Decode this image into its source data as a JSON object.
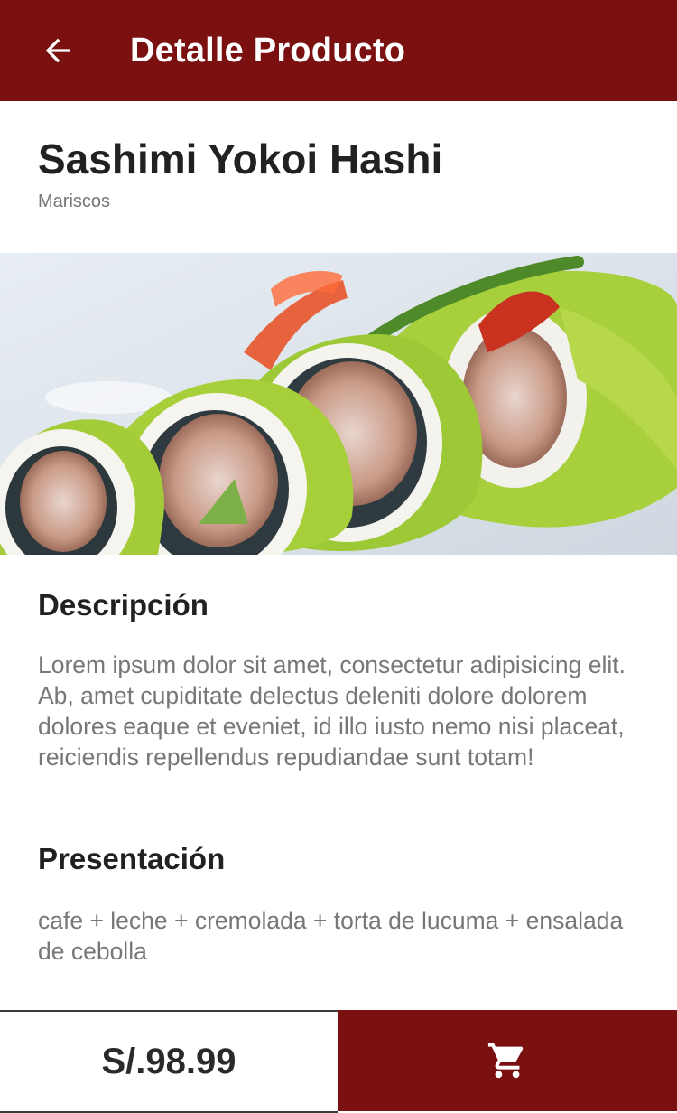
{
  "appbar": {
    "title": "Detalle Producto",
    "back_icon": "arrow-left-icon"
  },
  "product": {
    "name": "Sashimi Yokoi Hashi",
    "category": "Mariscos",
    "image_alt": "sushi-roll-photo"
  },
  "description": {
    "heading": "Descripción",
    "text": "Lorem ipsum dolor sit amet, consectetur adipisicing elit. Ab, amet cupiditate delectus deleniti dolore dolorem dolores eaque et eveniet, id illo iusto nemo nisi placeat, reiciendis repellendus repudiandae sunt totam!"
  },
  "presentation": {
    "heading": "Presentación",
    "text": "cafe + leche + cremolada + torta de lucuma + ensalada de cebolla"
  },
  "footer": {
    "price": "S/.98.99",
    "cart_icon": "shopping-cart-icon"
  },
  "colors": {
    "primary": "#7a1010",
    "text_dark": "#212121",
    "text_muted": "#777777"
  }
}
